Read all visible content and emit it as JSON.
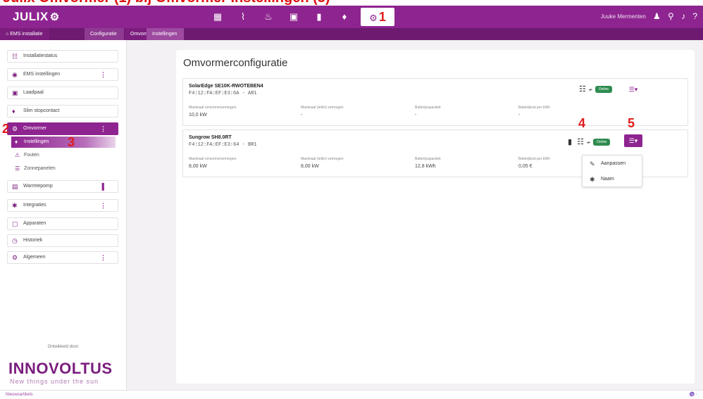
{
  "caption": {
    "text": "Julix Omvormer (1) bij Omvormer Instellingen (3)"
  },
  "header": {
    "logo": "JULIX",
    "nav_icons": [
      "dashboard-icon",
      "chart-icon",
      "brain-icon",
      "display-icon",
      "battery-switch-icon",
      "plug-icon",
      "settings-icon"
    ],
    "active_tab_number": "1",
    "user_name": "Juuke Mermenten"
  },
  "breadcrumb": {
    "items": [
      "EMS installatie",
      "Configuratie",
      "Omvormer",
      "Instellingen"
    ]
  },
  "sidebar": {
    "items": [
      {
        "label": "Installatiestatus",
        "icon": "status-icon"
      },
      {
        "label": "EMS instellingen",
        "icon": "ems-icon",
        "more": "⋮"
      },
      {
        "label": "Laadpaal",
        "icon": "charger-icon"
      },
      {
        "label": "Slim stopcontact",
        "icon": "plug-icon"
      },
      {
        "label": "Omvormer",
        "icon": "inverter-icon",
        "more": "⋮"
      },
      {
        "label": "Warmtepomp",
        "icon": "heatpump-icon",
        "more": "▌"
      },
      {
        "label": "Integraties",
        "icon": "puzzle-icon",
        "more": "⋮"
      },
      {
        "label": "Apparaten",
        "icon": "devices-icon"
      },
      {
        "label": "Historiek",
        "icon": "history-icon"
      },
      {
        "label": "Algemeen",
        "icon": "gear-icon",
        "more": "⋮"
      }
    ],
    "sub_items": [
      {
        "label": "Instellingen",
        "icon": "dot-icon"
      },
      {
        "label": "Fouten",
        "icon": "warning-icon"
      },
      {
        "label": "Zonnepanelen",
        "icon": "solar-panel-icon"
      }
    ],
    "labels": {
      "two": "2",
      "three": "3"
    },
    "powered_by": "Ontwikkeld door:",
    "brand": "INNOVOLTUS",
    "tagline": "New things under the sun"
  },
  "main": {
    "title": "Omvormerconfiguratie",
    "field_labels": [
      "Maximaal omvormervermogen",
      "Maximaal (teller) vermogen",
      "Batterijcapaciteit",
      "Batterijkost per kWh"
    ],
    "inverters": [
      {
        "name": "SolarEdge SE10K-RWOTEBEN4",
        "mac": "F4:12:FA:EF:E3:6A - AR1",
        "values": [
          "10,0 kW",
          "-",
          "-",
          "-"
        ],
        "status": "Online"
      },
      {
        "name": "Sungrow SH8.0RT",
        "mac": "F4:12:FA:EF:E3:64 - BR1",
        "values": [
          "8,00 kW",
          "8,00 kW",
          "12,8 kWh",
          "0,05 €"
        ],
        "status": "Online"
      }
    ],
    "step_labels": {
      "four": "4",
      "five": "5"
    },
    "dropdown": [
      "Aanpassen",
      "Naam"
    ]
  },
  "footer": {
    "left": "Nieuwsartikels",
    "right": "♑ ◦"
  }
}
